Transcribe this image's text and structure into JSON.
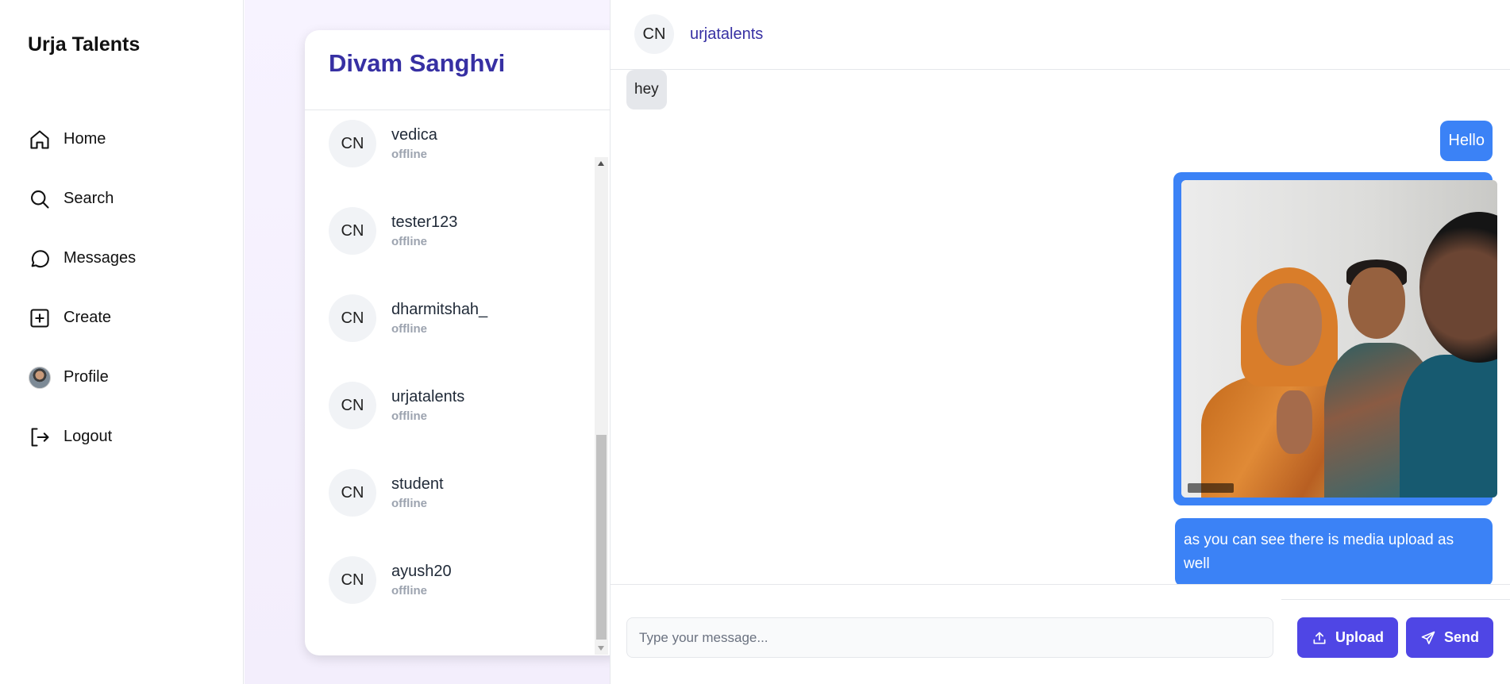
{
  "app": {
    "brand": "Urja Talents"
  },
  "sidebar": {
    "items": [
      {
        "label": "Home",
        "icon": "home-icon"
      },
      {
        "label": "Search",
        "icon": "search-icon"
      },
      {
        "label": "Messages",
        "icon": "message-circle-icon"
      },
      {
        "label": "Create",
        "icon": "plus-square-icon"
      },
      {
        "label": "Profile",
        "icon": "avatar"
      },
      {
        "label": "Logout",
        "icon": "logout-icon"
      }
    ]
  },
  "contacts_panel": {
    "title": "Divam Sanghvi",
    "contacts": [
      {
        "avatar": "CN",
        "name": "vedica",
        "status": "offline"
      },
      {
        "avatar": "CN",
        "name": "tester123",
        "status": "offline"
      },
      {
        "avatar": "CN",
        "name": "dharmitshah_",
        "status": "offline"
      },
      {
        "avatar": "CN",
        "name": "urjatalents",
        "status": "offline"
      },
      {
        "avatar": "CN",
        "name": "student",
        "status": "offline"
      },
      {
        "avatar": "CN",
        "name": "ayush20",
        "status": "offline"
      }
    ]
  },
  "chat": {
    "header": {
      "avatar": "CN",
      "name": "urjatalents"
    },
    "messages": {
      "incoming_1": "hey",
      "outgoing_1": "Hello",
      "outgoing_2": "as you can see there is media upload as well"
    },
    "composer": {
      "placeholder": "Type your message...",
      "upload_label": "Upload",
      "send_label": "Send"
    }
  },
  "colors": {
    "accent": "#4f46e5",
    "title": "#3730a3",
    "bubble_out": "#3b82f6",
    "bubble_in": "#e5e7eb"
  }
}
